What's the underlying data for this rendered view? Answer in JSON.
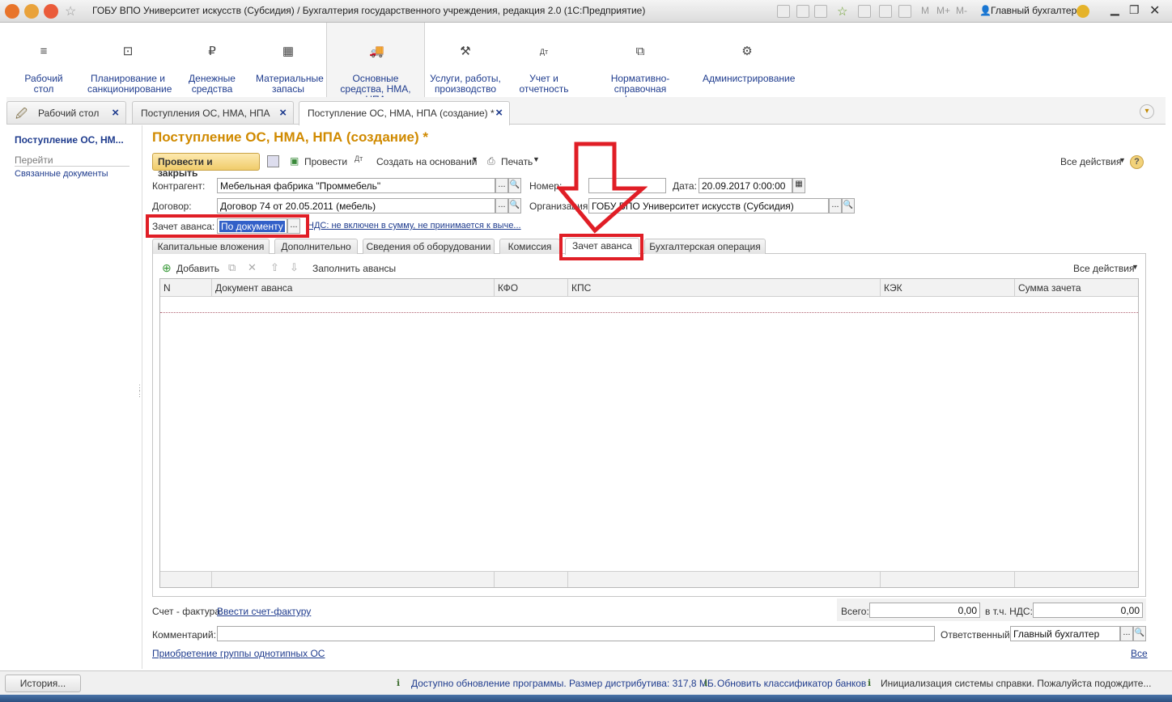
{
  "window": {
    "title": "ГОБУ ВПО Университет искусств (Субсидия) / Бухгалтерия государственного учреждения, редакция 2.0  (1С:Предприятие)",
    "user": "Главный бухгалтер",
    "m": "M",
    "mplus": "M+",
    "mminus": "M-"
  },
  "sections": [
    {
      "label": "Рабочий стол",
      "icon": "≡"
    },
    {
      "label": "Планирование и санкционирование",
      "icon": "⊡"
    },
    {
      "label": "Денежные средства",
      "icon": "₽"
    },
    {
      "label": "Материальные запасы",
      "icon": "▦"
    },
    {
      "label": "Основные средства, НМА, НПА",
      "icon": "🚚"
    },
    {
      "label": "Услуги, работы, производство",
      "icon": "⚒"
    },
    {
      "label": "Учет и отчетность",
      "icon": "Дт"
    },
    {
      "label": "Нормативно-справочная информация",
      "icon": "⧉"
    },
    {
      "label": "Администрирование",
      "icon": "⚙"
    }
  ],
  "tabs": [
    {
      "label": "Рабочий стол"
    },
    {
      "label": "Поступления ОС, НМА, НПА"
    },
    {
      "label": "Поступление ОС, НМА, НПА (создание) *"
    }
  ],
  "nav": {
    "title": "Поступление ОС, НМ...",
    "goto": "Перейти",
    "related": "Связанные документы"
  },
  "form": {
    "title": "Поступление ОС, НМА, НПА (создание) *",
    "post_close": "Провести и закрыть",
    "post": "Провести",
    "create_based": "Создать на основании",
    "print": "Печать",
    "all_actions": "Все действия",
    "help": "?",
    "kontragent_label": "Контрагент:",
    "kontragent": "Мебельная фабрика \"Проммебель\"",
    "nomer_label": "Номер:",
    "nomer": "",
    "date_label": "Дата:",
    "date": "20.09.2017  0:00:00",
    "dogovor_label": "Договор:",
    "dogovor": "Договор 74 от 20.05.2011 (мебель)",
    "org_label": "Организация:",
    "org": "ГОБУ ВПО Университет искусств (Субсидия)",
    "zachet_label": "Зачет аванса:",
    "zachet": "По документу",
    "nds_link": "НДС: не включен в сумму, не принимается к выче..."
  },
  "inner_tabs": [
    "Капитальные вложения",
    "Дополнительно",
    "Сведения об оборудовании",
    "Комиссия",
    "Зачет аванса",
    "Бухгалтерская операция"
  ],
  "grid": {
    "add": "Добавить",
    "fill": "Заполнить авансы",
    "all_actions": "Все действия",
    "columns": [
      "N",
      "Документ аванса",
      "КФО",
      "КПС",
      "КЭК",
      "Сумма зачета"
    ]
  },
  "bottom": {
    "invoice_label": "Счет - фактура:",
    "invoice_link": "Ввести счет-фактуру",
    "total_label": "Всего:",
    "total": "0,00",
    "vat_label": "в т.ч. НДС:",
    "vat": "0,00",
    "comment_label": "Комментарий:",
    "responsible_label": "Ответственный:",
    "responsible": "Главный бухгалтер",
    "group_link": "Приобретение группы однотипных ОС",
    "all_link": "Все"
  },
  "status": {
    "history": "История...",
    "msg1": "Доступно обновление программы. Размер дистрибутива: 317,8 МБ.",
    "msg2": "Обновить классификатор банков",
    "msg3": "Инициализация системы справки. Пожалуйста подождите..."
  },
  "colors": {
    "accent": "#d08a00",
    "link": "#1f3c8e",
    "annotation": "#e01e26"
  }
}
